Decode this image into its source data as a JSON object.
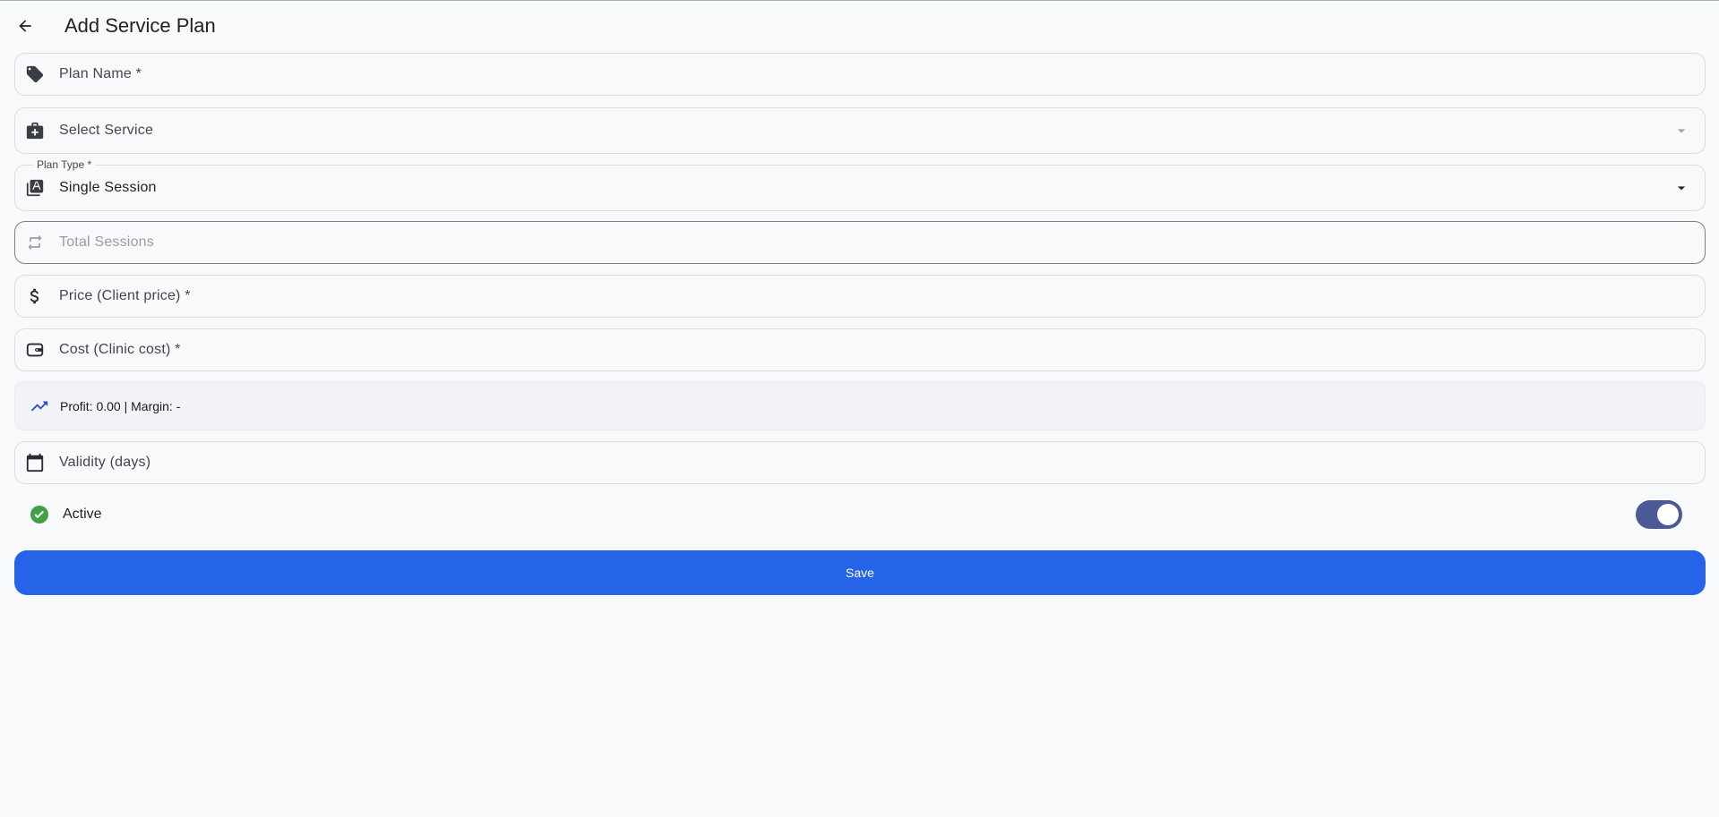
{
  "header": {
    "title": "Add Service Plan",
    "back_icon": "arrow-back-icon"
  },
  "form": {
    "plan_name": {
      "label": "Plan Name *",
      "icon": "tag-icon"
    },
    "service": {
      "label": "Select Service",
      "icon": "medical-bag-icon"
    },
    "plan_type": {
      "label": "Plan Type *",
      "value": "Single Session",
      "icon": "library-icon"
    },
    "total_sessions": {
      "label": "Total Sessions",
      "icon": "repeat-icon"
    },
    "price": {
      "label": "Price (Client price) *",
      "icon": "dollar-icon"
    },
    "cost": {
      "label": "Cost (Clinic cost) *",
      "icon": "wallet-icon"
    },
    "profit": {
      "text": "Profit: 0.00 | Margin: -",
      "icon": "trending-up-icon"
    },
    "validity": {
      "label": "Validity (days)",
      "icon": "calendar-icon"
    },
    "active": {
      "label": "Active",
      "enabled": true,
      "icon": "check-circle-icon"
    }
  },
  "actions": {
    "save_label": "Save"
  },
  "colors": {
    "primary": "#2563e8",
    "switch_track": "#4a5a94",
    "active_check": "#43a047",
    "trend_icon": "#2650b8"
  }
}
